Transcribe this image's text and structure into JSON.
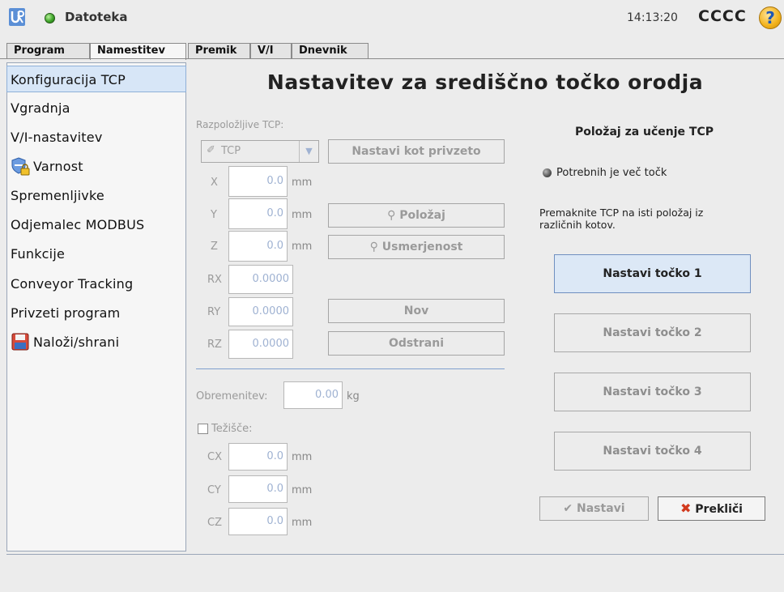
{
  "header": {
    "app_title": "Datoteka",
    "time": "14:13:20",
    "robot_name": "CCCC",
    "help_symbol": "?",
    "logo_icon": "ur-logo-icon",
    "status_icon": "status-green-icon"
  },
  "tabs": {
    "program": "Program",
    "setup": "Namestitev",
    "move": "Premik",
    "io": "V/I",
    "log": "Dnevnik"
  },
  "nav": {
    "items": [
      {
        "label": "Konfiguracija TCP"
      },
      {
        "label": "Vgradnja"
      },
      {
        "label": "V/I-nastavitev"
      },
      {
        "label": "Varnost",
        "icon": "shield-lock-icon"
      },
      {
        "label": "Spremenljivke"
      },
      {
        "label": "Odjemalec MODBUS"
      },
      {
        "label": "Funkcije"
      },
      {
        "label": "Conveyor Tracking"
      },
      {
        "label": "Privzeti program"
      },
      {
        "label": "Naloži/shrani",
        "icon": "floppy-disk-icon"
      }
    ]
  },
  "main": {
    "title": "Nastavitev za središčno točko orodja",
    "available_tcp_label": "Razpoložljive TCP:",
    "tcp_select_value": "TCP",
    "set_default_btn": "Nastavi kot privzeto",
    "position_btn": "Položaj",
    "orientation_btn": "Usmerjenost",
    "new_btn": "Nov",
    "remove_btn": "Odstrani",
    "coords": {
      "x": {
        "label": "X",
        "value": "0.0",
        "unit": "mm"
      },
      "y": {
        "label": "Y",
        "value": "0.0",
        "unit": "mm"
      },
      "z": {
        "label": "Z",
        "value": "0.0",
        "unit": "mm"
      },
      "rx": {
        "label": "RX",
        "value": "0.0000"
      },
      "ry": {
        "label": "RY",
        "value": "0.0000"
      },
      "rz": {
        "label": "RZ",
        "value": "0.0000"
      }
    },
    "payload_label": "Obremenitev:",
    "payload_value": "0.00",
    "payload_unit": "kg",
    "cog_label": "Težišče:",
    "cog": {
      "cx": {
        "label": "CX",
        "value": "0.0",
        "unit": "mm"
      },
      "cy": {
        "label": "CY",
        "value": "0.0",
        "unit": "mm"
      },
      "cz": {
        "label": "CZ",
        "value": "0.0",
        "unit": "mm"
      }
    },
    "teach": {
      "title": "Položaj za učenje TCP",
      "status": "Potrebnih je več točk",
      "instructions_line1": "Premaknite TCP na isti položaj iz",
      "instructions_line2": "različnih kotov.",
      "point_buttons": [
        "Nastavi točko 1",
        "Nastavi točko 2",
        "Nastavi točko 3",
        "Nastavi točko 4"
      ],
      "set_btn": "Nastavi",
      "cancel_btn": "Prekliči"
    }
  }
}
